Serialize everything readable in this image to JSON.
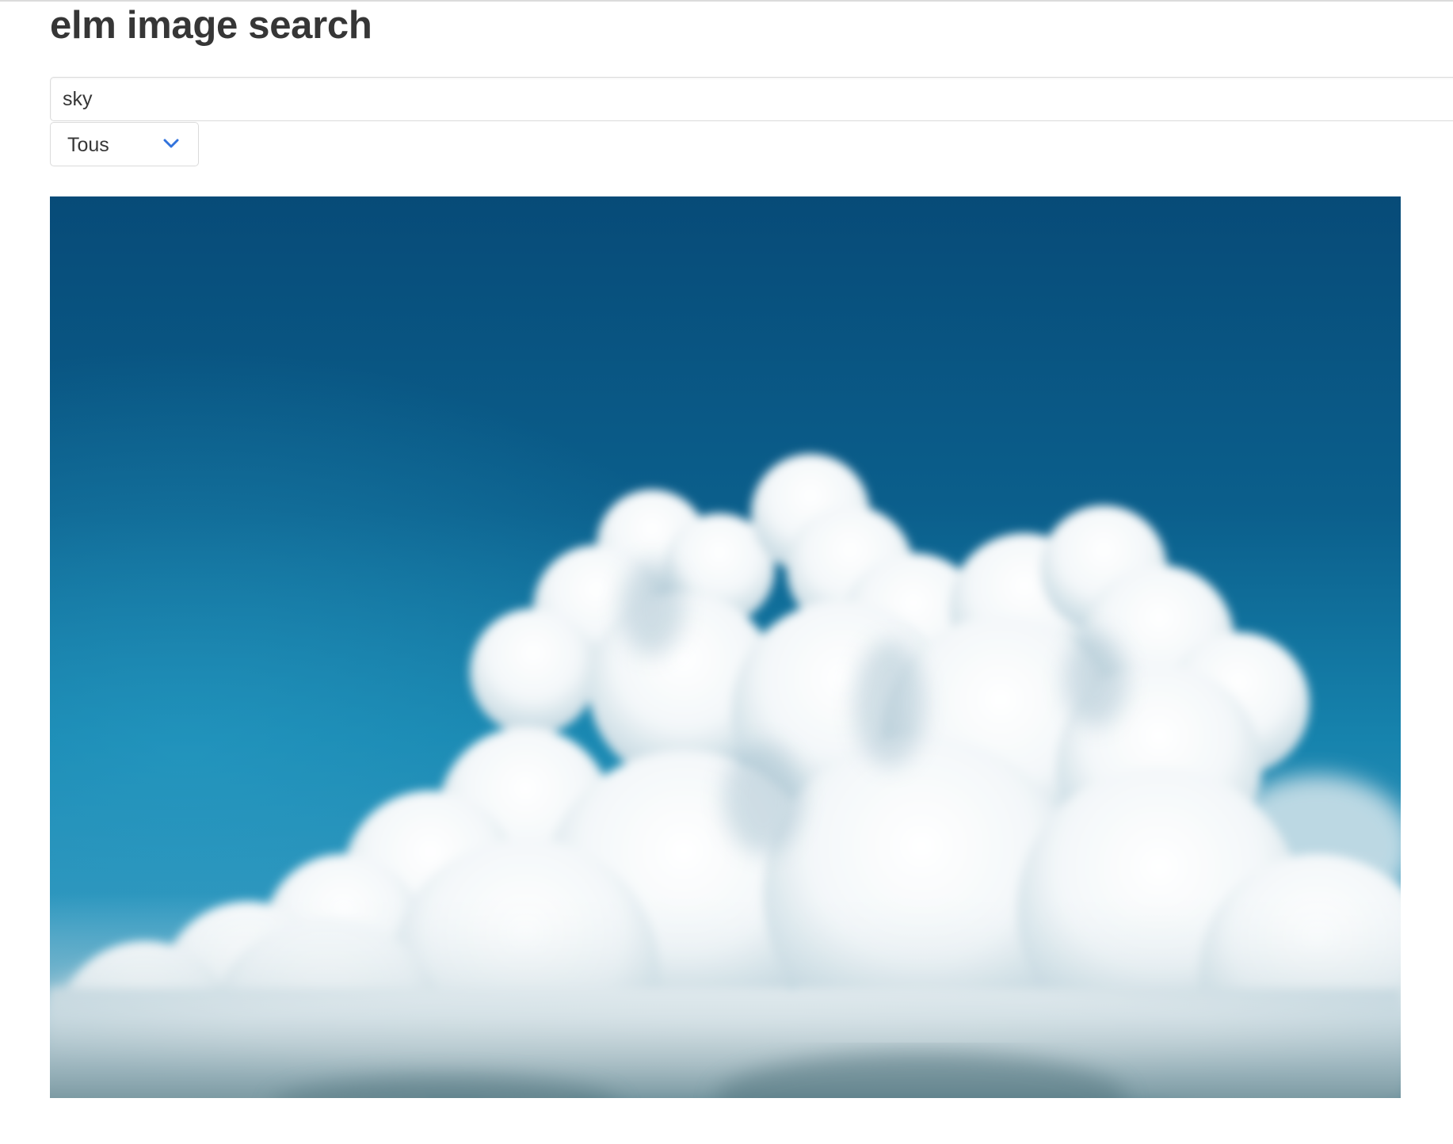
{
  "header": {
    "title": "elm image search"
  },
  "search": {
    "value": "sky"
  },
  "filter": {
    "selected": "Tous"
  },
  "results": {
    "image_subject": "cumulus clouds in a blue sky"
  },
  "colors": {
    "text": "#363636",
    "border": "#dbdbdb",
    "accent": "#3273dc",
    "sky_top": "#084a75",
    "sky_bottom": "#2a90b8"
  },
  "icons": {
    "select_arrow": "chevron-down-icon"
  }
}
